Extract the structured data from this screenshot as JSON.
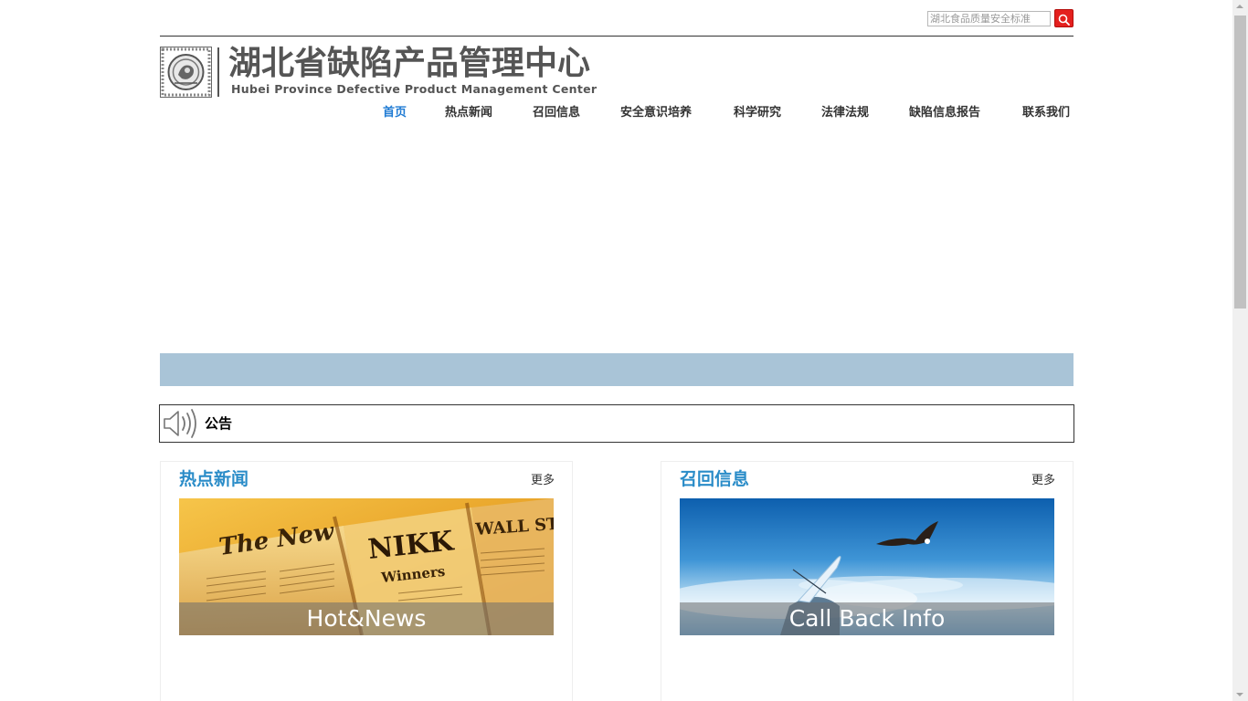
{
  "search": {
    "placeholder": "湖北食品质量安全标准"
  },
  "header": {
    "title_cn": "湖北省缺陷产品管理中心",
    "title_en": "Hubei Province Defective Product Management Center"
  },
  "nav": {
    "items": [
      {
        "label": "首页",
        "active": true
      },
      {
        "label": "热点新闻",
        "active": false
      },
      {
        "label": "召回信息",
        "active": false
      },
      {
        "label": "安全意识培养",
        "active": false
      },
      {
        "label": "科学研究",
        "active": false
      },
      {
        "label": "法律法规",
        "active": false
      },
      {
        "label": "缺陷信息报告",
        "active": false
      },
      {
        "label": "联系我们",
        "active": false
      }
    ]
  },
  "notice": {
    "label": "公告"
  },
  "panels": {
    "hot_news": {
      "title": "热点新闻",
      "more": "更多",
      "caption": "Hot&News"
    },
    "recall": {
      "title": "召回信息",
      "more": "更多",
      "caption": "Call Back Info"
    }
  },
  "colors": {
    "accent_blue": "#2a8cc8",
    "nav_active": "#1e7ad3",
    "search_red": "#e4201e",
    "banner_strip": "#a9c4d7"
  },
  "icons": {
    "search_button": "search-icon",
    "notice": "speaker-icon",
    "logo": "logo-seal-icon"
  }
}
